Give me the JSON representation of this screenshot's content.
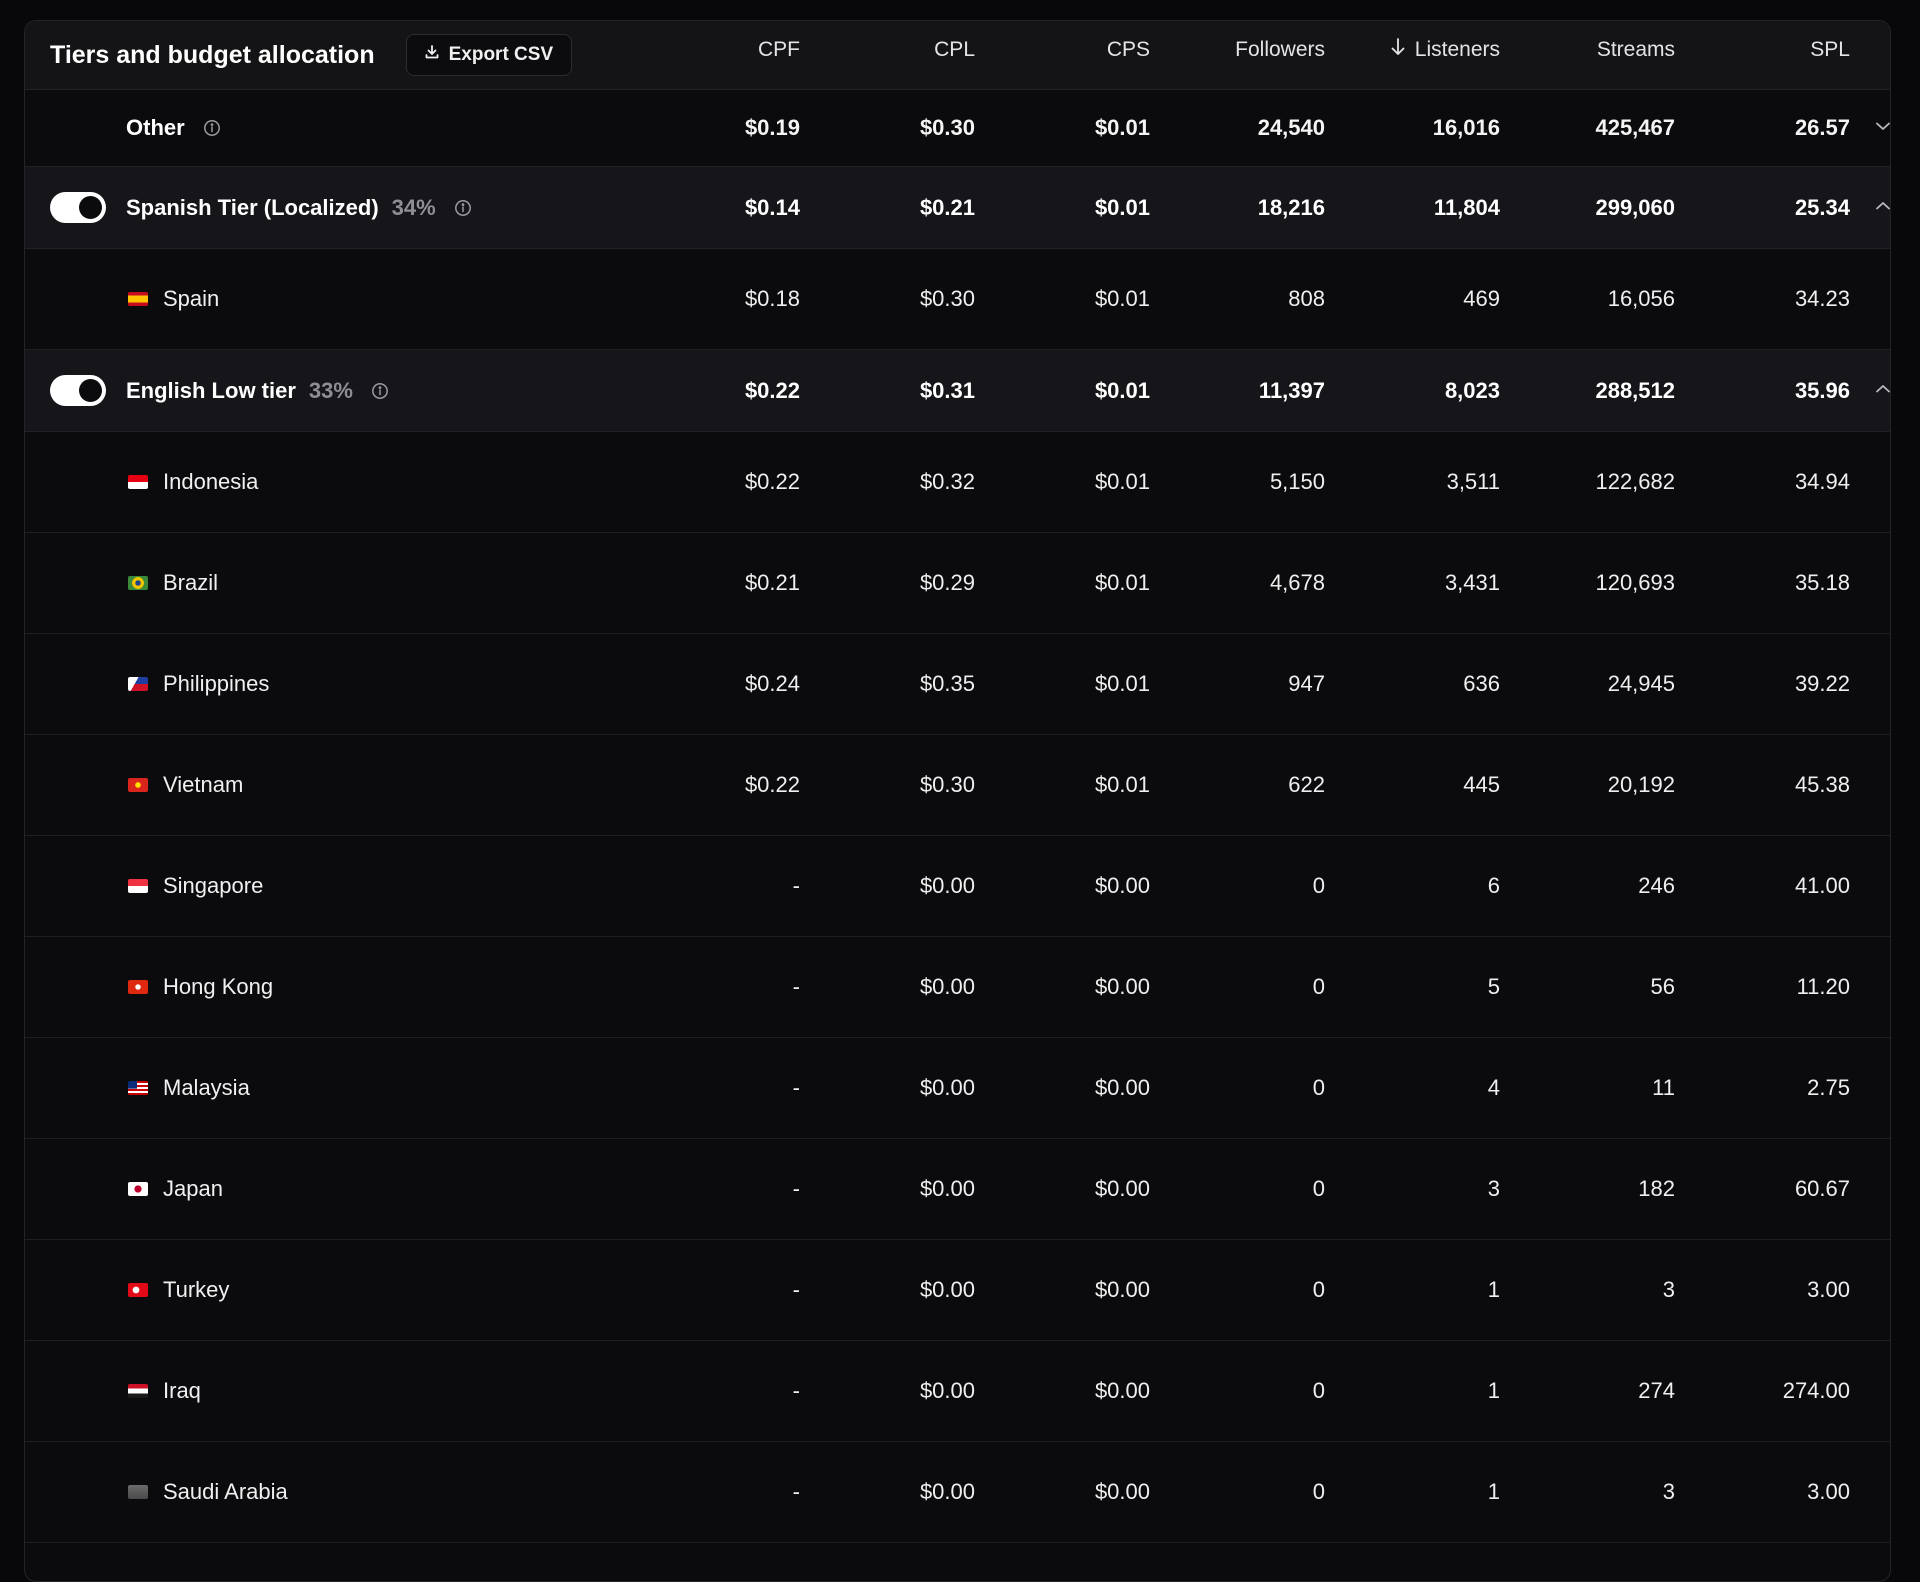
{
  "header": {
    "title": "Tiers and budget allocation",
    "export_label": "Export CSV",
    "columns": [
      "CPF",
      "CPL",
      "CPS",
      "Followers",
      "Listeners",
      "Streams",
      "SPL"
    ],
    "sorted_column": "Listeners",
    "sort_direction": "descending"
  },
  "tiers": [
    {
      "name": "Other",
      "percent": "",
      "toggle": false,
      "expanded": false,
      "values": [
        "$0.19",
        "$0.30",
        "$0.01",
        "24,540",
        "16,016",
        "425,467",
        "26.57"
      ]
    },
    {
      "name": "Spanish Tier (Localized)",
      "percent": "34%",
      "toggle": true,
      "expanded": true,
      "values": [
        "$0.14",
        "$0.21",
        "$0.01",
        "18,216",
        "11,804",
        "299,060",
        "25.34"
      ],
      "countries": [
        {
          "name": "Spain",
          "flag": "spain-flag",
          "values": [
            "$0.18",
            "$0.30",
            "$0.01",
            "808",
            "469",
            "16,056",
            "34.23"
          ]
        }
      ]
    },
    {
      "name": "English Low tier",
      "percent": "33%",
      "toggle": true,
      "expanded": true,
      "values": [
        "$0.22",
        "$0.31",
        "$0.01",
        "11,397",
        "8,023",
        "288,512",
        "35.96"
      ],
      "countries": [
        {
          "name": "Indonesia",
          "flag": "indonesia-flag",
          "values": [
            "$0.22",
            "$0.32",
            "$0.01",
            "5,150",
            "3,511",
            "122,682",
            "34.94"
          ]
        },
        {
          "name": "Brazil",
          "flag": "brazil-flag",
          "values": [
            "$0.21",
            "$0.29",
            "$0.01",
            "4,678",
            "3,431",
            "120,693",
            "35.18"
          ]
        },
        {
          "name": "Philippines",
          "flag": "philippines-flag",
          "values": [
            "$0.24",
            "$0.35",
            "$0.01",
            "947",
            "636",
            "24,945",
            "39.22"
          ]
        },
        {
          "name": "Vietnam",
          "flag": "vietnam-flag",
          "values": [
            "$0.22",
            "$0.30",
            "$0.01",
            "622",
            "445",
            "20,192",
            "45.38"
          ]
        },
        {
          "name": "Singapore",
          "flag": "singapore-flag",
          "values": [
            "-",
            "$0.00",
            "$0.00",
            "0",
            "6",
            "246",
            "41.00"
          ]
        },
        {
          "name": "Hong Kong",
          "flag": "hong-kong-flag",
          "values": [
            "-",
            "$0.00",
            "$0.00",
            "0",
            "5",
            "56",
            "11.20"
          ]
        },
        {
          "name": "Malaysia",
          "flag": "malaysia-flag",
          "values": [
            "-",
            "$0.00",
            "$0.00",
            "0",
            "4",
            "11",
            "2.75"
          ]
        },
        {
          "name": "Japan",
          "flag": "japan-flag",
          "values": [
            "-",
            "$0.00",
            "$0.00",
            "0",
            "3",
            "182",
            "60.67"
          ]
        },
        {
          "name": "Turkey",
          "flag": "turkey-flag",
          "values": [
            "-",
            "$0.00",
            "$0.00",
            "0",
            "1",
            "3",
            "3.00"
          ]
        },
        {
          "name": "Iraq",
          "flag": "iraq-flag",
          "values": [
            "-",
            "$0.00",
            "$0.00",
            "0",
            "1",
            "274",
            "274.00"
          ]
        },
        {
          "name": "Saudi Arabia",
          "flag": "saudi-arabia-flag",
          "values": [
            "-",
            "$0.00",
            "$0.00",
            "0",
            "1",
            "3",
            "3.00"
          ]
        }
      ]
    }
  ]
}
